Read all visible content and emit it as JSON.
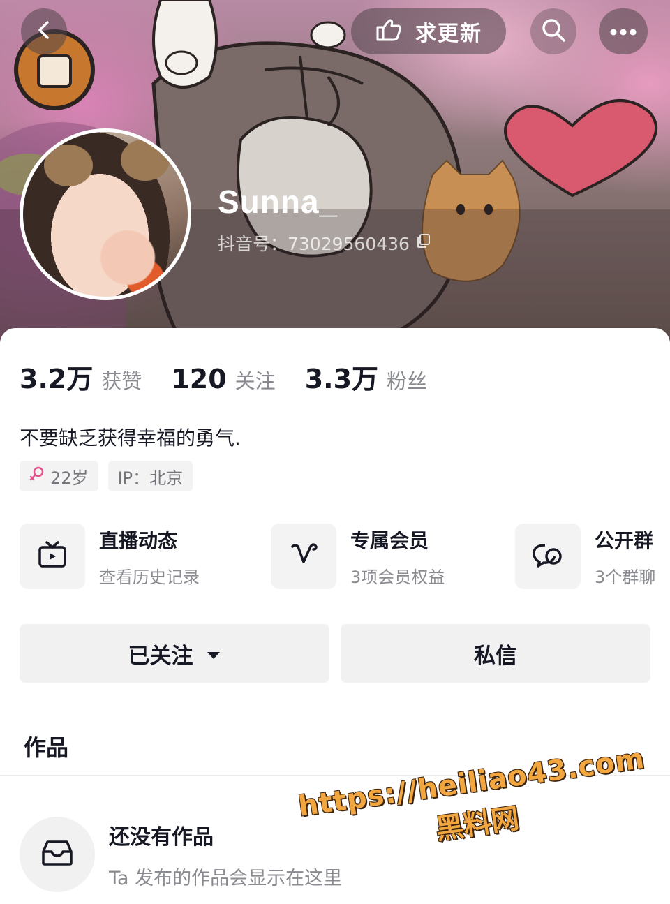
{
  "header": {
    "update_label": "求更新",
    "icons": {
      "back": "back-icon",
      "search": "search-icon",
      "more": "more-icon",
      "update": "hand-point-icon",
      "copy": "copy-icon"
    }
  },
  "profile": {
    "username": "Sunna_",
    "douyin_id": "抖音号：73029560436"
  },
  "stats": [
    {
      "value": "3.2万",
      "label": "获赞"
    },
    {
      "value": "120",
      "label": "关注"
    },
    {
      "value": "3.3万",
      "label": "粉丝"
    }
  ],
  "bio": "不要缺乏获得幸福的勇气.",
  "tags": {
    "age": "22岁",
    "ip": "IP：北京"
  },
  "features": [
    {
      "title": "直播动态",
      "subtitle": "查看历史记录",
      "icon": "tv-icon"
    },
    {
      "title": "专属会员",
      "subtitle": "3项会员权益",
      "icon": "heart-v-icon"
    },
    {
      "title": "公开群",
      "subtitle": "3个群聊",
      "icon": "chat-bubbles-icon"
    }
  ],
  "actions": {
    "follow_label": "已关注",
    "message_label": "私信"
  },
  "tabs": {
    "works": "作品"
  },
  "empty_state": {
    "title": "还没有作品",
    "subtitle": "Ta 发布的作品会显示在这里",
    "icon": "inbox-icon"
  },
  "watermark": {
    "url": "https://heiliao43.com",
    "site": "黑料网"
  },
  "colors": {
    "text_primary": "#161823",
    "text_secondary": "#8a8b91",
    "button_bg": "#f1f1f2",
    "watermark": "#f2a640"
  }
}
